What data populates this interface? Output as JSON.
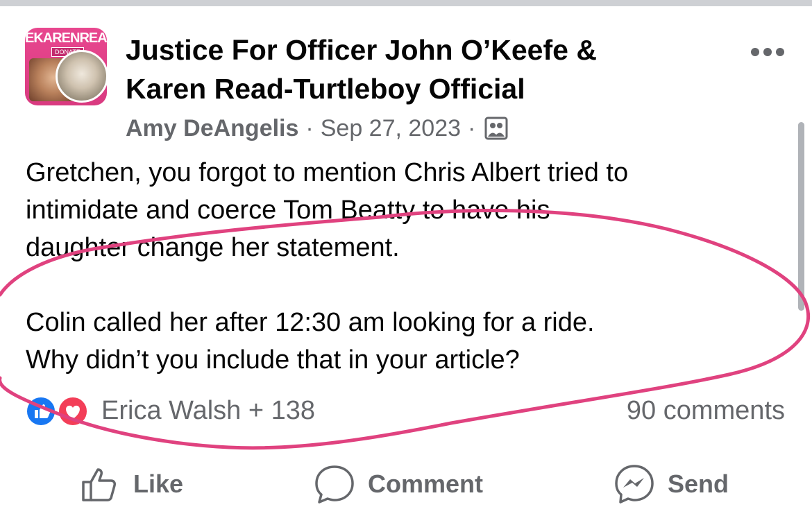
{
  "post": {
    "group_name_line1": "Justice For Officer John O’Keefe &",
    "group_name_line2": "Karen Read-Turtleboy Official",
    "avatar_banner": "EKARENREAD.",
    "avatar_donate": "DONATE",
    "author": "Amy DeAngelis",
    "separator": "·",
    "date": "Sep 27, 2023",
    "audience_icon": "members-icon",
    "text_lines": [
      "Gretchen, you forgot to mention Chris Albert tried to",
      "intimidate and coerce Tom Beatty to have his",
      "daughter change her statement.",
      "Colin called her after 12:30 am looking for a ride.",
      "Why didn’t you include that in your article?"
    ]
  },
  "reactions": {
    "icons": [
      "like-reaction-icon",
      "love-reaction-icon"
    ],
    "summary": "Erica Walsh + 138",
    "comments": "90 comments"
  },
  "actions": {
    "like_label": "Like",
    "comment_label": "Comment",
    "send_label": "Send"
  },
  "colors": {
    "text_primary": "#050505",
    "text_secondary": "#65676b",
    "like_blue": "#1877f2",
    "love_red": "#f33e58",
    "annotation_pink": "#e0427f",
    "avatar_pink": "#e8478f"
  }
}
